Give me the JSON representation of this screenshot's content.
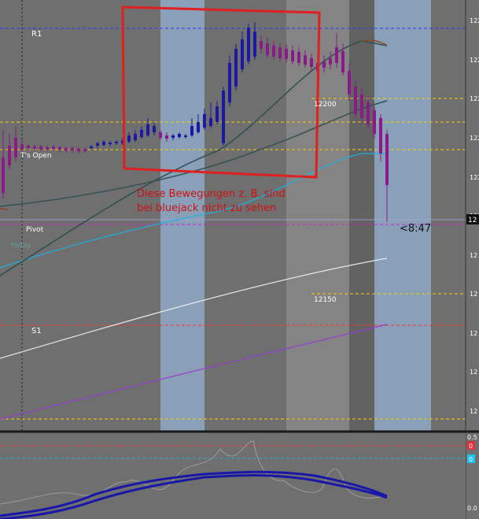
{
  "colors": {
    "background": "#6f6f6f",
    "session_band_light": "#8aa0b8",
    "session_band_gray": "#848484",
    "session_band_dark": "#626262",
    "up_candle": "#1a1aa0",
    "down_candle": "#8a1a8a",
    "pivot_line": "#d020d0",
    "r1_s1_line": "#ff3030",
    "level_line": "#ffd000",
    "annotation": "#d01010",
    "ma_fast": "#2e4e4e",
    "ma_slow": "#355050",
    "cyan_ma": "#20b0e0",
    "white_ma": "#e8e8e8",
    "violet_ma": "#9a3ad0",
    "indicator_line": "#1818a8",
    "indicator_thin": "#a8a8a8"
  },
  "labels": {
    "r1": "R1",
    "open": "T's Open",
    "pivot": "Pivot",
    "today": "today",
    "s1": "S1",
    "level_12200": "12200",
    "level_12150": "12150",
    "countdown": "<8:47",
    "annotation_line1": "Diese Bewegungen z. B. sind",
    "annotation_line2": "bei bluejack nicht zu sehen"
  },
  "price_axis": {
    "ticks": [
      "122",
      "122",
      "122",
      "122",
      "122",
      "122",
      "12",
      "12",
      "12",
      "12",
      "12",
      "12",
      "12",
      "12"
    ],
    "current_price_tag": "12"
  },
  "indicator_axis": {
    "ticks": [
      "0.5",
      "0.0"
    ],
    "marker_red": "0",
    "marker_cyan": "0"
  }
}
